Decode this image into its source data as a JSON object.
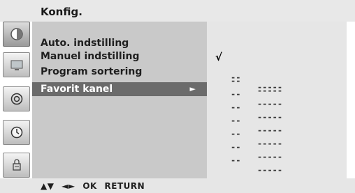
{
  "header": {
    "title": "Konfig."
  },
  "sidebar": {
    "tabs": [
      {
        "icon": "picture-icon",
        "active": true
      },
      {
        "icon": "tv-screen-icon",
        "active": false
      },
      {
        "icon": "sound-icon",
        "active": false
      },
      {
        "icon": "clock-icon",
        "active": false
      },
      {
        "icon": "lock-icon",
        "active": false
      }
    ]
  },
  "menu": {
    "items": [
      {
        "label": "Auto. indstilling",
        "selected": false
      },
      {
        "label": "Manuel indstilling",
        "selected": false
      },
      {
        "label": "Program sortering",
        "selected": false
      },
      {
        "label": "Favorit kanel",
        "selected": true,
        "arrow": "►"
      }
    ]
  },
  "favorites": {
    "check_mark": "√",
    "rows": [
      {
        "number": "--",
        "name": "-----",
        "checked": true
      },
      {
        "number": "--",
        "name": "-----",
        "checked": false
      },
      {
        "number": "--",
        "name": "-----",
        "checked": false
      },
      {
        "number": "--",
        "name": "-----",
        "checked": false
      },
      {
        "number": "--",
        "name": "-----",
        "checked": false
      },
      {
        "number": "--",
        "name": "-----",
        "checked": false
      },
      {
        "number": "--",
        "name": "-----",
        "checked": false
      },
      {
        "number": "--",
        "name": "-----",
        "checked": false
      }
    ]
  },
  "footer": {
    "updown": "▲▼",
    "leftright": "◄►",
    "ok": "OK",
    "return": "RETURN"
  }
}
